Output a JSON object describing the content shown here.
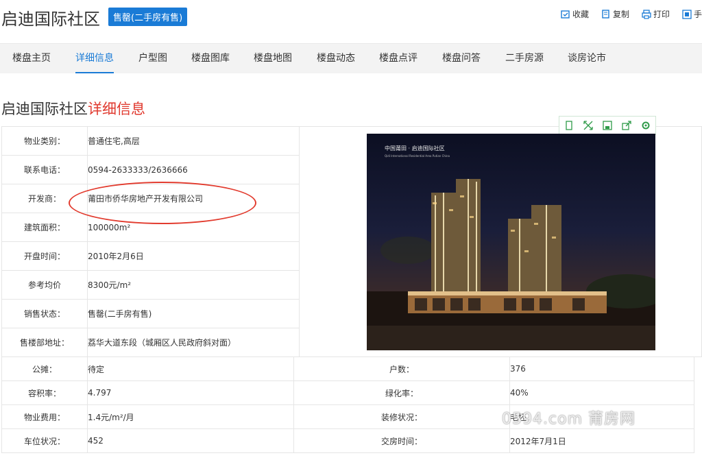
{
  "header": {
    "title": "启迪国际社区",
    "badge": "售罄(二手房有售)",
    "tools": [
      "收藏",
      "复制",
      "打印",
      "手"
    ]
  },
  "tabs": [
    "楼盘主页",
    "详细信息",
    "户型图",
    "楼盘图库",
    "楼盘地图",
    "楼盘动态",
    "楼盘点评",
    "楼盘问答",
    "二手房源",
    "谈房论市"
  ],
  "active_tab": "详细信息",
  "section": {
    "name": "启迪国际社区",
    "accent": "详细信息"
  },
  "details": [
    {
      "label": "物业类别：",
      "value": "普通住宅,高层"
    },
    {
      "label": "联系电话：",
      "value": "0594-2633333/2636666"
    },
    {
      "label": "开发商：",
      "value": "莆田市侨华房地产开发有限公司"
    },
    {
      "label": "建筑面积：",
      "value": "100000m²"
    },
    {
      "label": "开盘时间：",
      "value": "2010年2月6日"
    },
    {
      "label": "参考均价",
      "value": "8300元/m²"
    },
    {
      "label": "销售状态：",
      "value": "售罄(二手房有售)"
    },
    {
      "label": "售楼部地址：",
      "value": "荔华大道东段（城厢区人民政府斜对面）"
    }
  ],
  "details2": [
    {
      "label": "公摊：",
      "value": "待定",
      "label2": "户数：",
      "value2": "376"
    },
    {
      "label": "容积率：",
      "value": "4.797",
      "label2": "绿化率：",
      "value2": "40%"
    },
    {
      "label": "物业费用：",
      "value": "1.4元/m²/月",
      "label2": "装修状况：",
      "value2": "毛坯"
    },
    {
      "label": "车位状况：",
      "value": "452",
      "label2": "交房时间：",
      "value2": "2012年7月1日"
    }
  ],
  "photo": {
    "caption": "中国莆田 · 启迪国际社区",
    "caption_sub": "Qidi International Residential Area Putian China"
  },
  "watermark": "0594.com 莆房网",
  "colors": {
    "accent": "#1a7bd6",
    "highlight": "#e03a2f",
    "oval": "#e23b2e"
  },
  "icons": [
    "collect-icon",
    "copy-icon",
    "print-icon",
    "phone-icon"
  ]
}
